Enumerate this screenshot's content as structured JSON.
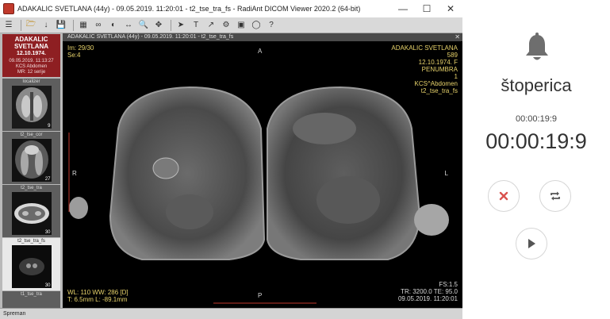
{
  "window": {
    "title": "ADAKALIC SVETLANA (44y) - 09.05.2019. 11:20:01 - t2_tse_tra_fs - RadiAnt DICOM Viewer 2020.2 (64-bit)",
    "minimize_icon": "minimize-icon",
    "maximize_icon": "maximize-icon",
    "close_icon": "close-icon"
  },
  "toolbar": {
    "tools": [
      "menu-icon",
      "open-folder-icon",
      "download-icon",
      "save-icon",
      "layout-grid-icon",
      "link-icon",
      "wl-icon",
      "measure-icon",
      "zoom-icon",
      "pan-icon",
      "cursor-icon",
      "text-icon",
      "export-icon",
      "settings-icon",
      "mpr-icon",
      "fusion-icon",
      "help-icon"
    ]
  },
  "sidebar": {
    "patient_name": "ADAKALIC SVETLANA",
    "patient_dob": "12.10.1974.",
    "study_datetime": "09.05.2019. 11:13:27",
    "study_desc": "KCS Abdomen",
    "study_mr": "MR: 12 serije",
    "series": [
      {
        "label": "localizer",
        "count": "9"
      },
      {
        "label": "t2_tse_cor",
        "count": "27"
      },
      {
        "label": "t2_tse_tra",
        "count": "30"
      },
      {
        "label": "t2_tse_tra_fs",
        "count": "30"
      },
      {
        "label": "t1_tse_tra",
        "count": ""
      }
    ]
  },
  "viewport": {
    "header": "ADAKALIC SVETLANA (44y) - 09.05.2019. 11:20:01 - t2_tse_tra_fs",
    "top_left": "Im: 29/30\nSe:4",
    "top_right": "ADAKALIC SVETLANA\n589\n12.10.1974. F\nPENUMBRA\n1\nKCS^Abdomen\nt2_tse_tra_fs",
    "orient_top": "A",
    "orient_bottom": "P",
    "orient_left": "R",
    "orient_right": "L",
    "bottom_left": "WL: 110 WW: 286 [D]\nT: 6.5mm L: -89.1mm",
    "bottom_right": "FS:1.5\nTR: 3200.0 TE: 95.0\n09.05.2019. 11:20:01"
  },
  "statusbar": {
    "text": "Spreman"
  },
  "stopwatch": {
    "bell_icon": "bell-icon",
    "title": "štoperica",
    "small_time": "00:00:19:9",
    "big_time": "00:00:19:9",
    "reset_icon": "close-icon",
    "lap_icon": "repeat-icon",
    "play_icon": "play-icon",
    "accent": "#d9534f"
  }
}
